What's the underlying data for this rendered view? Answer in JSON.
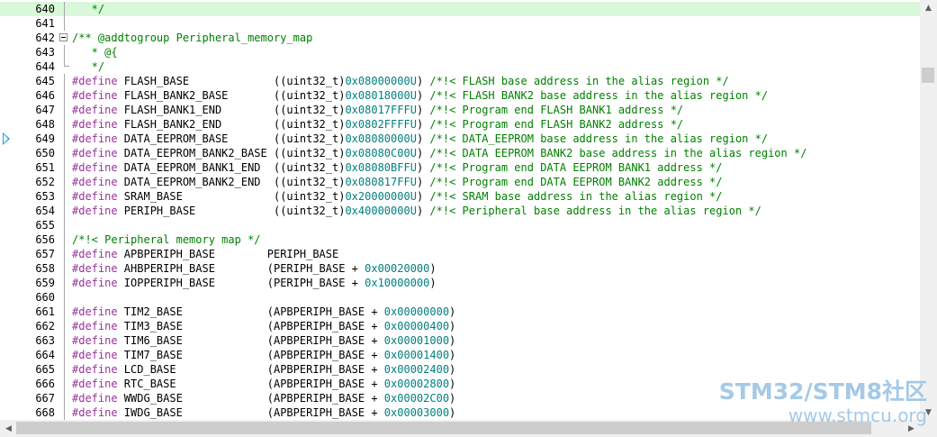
{
  "editor": {
    "lines": [
      {
        "num": "640",
        "tokens": [
          {
            "t": "   */",
            "c": "cm"
          }
        ]
      },
      {
        "num": "641",
        "tokens": []
      },
      {
        "num": "642",
        "tokens": [
          {
            "t": "/** @addtogroup Peripheral_memory_map",
            "c": "cm"
          }
        ]
      },
      {
        "num": "643",
        "tokens": [
          {
            "t": "   * @{",
            "c": "cm"
          }
        ]
      },
      {
        "num": "644",
        "tokens": [
          {
            "t": "   */",
            "c": "cm"
          }
        ]
      },
      {
        "num": "645",
        "tokens": [
          {
            "t": "#define",
            "c": "kw"
          },
          {
            "t": " FLASH_BASE             ((uint32_t)",
            "c": ""
          },
          {
            "t": "0x08000000U",
            "c": "num"
          },
          {
            "t": ") ",
            "c": ""
          },
          {
            "t": "/*!< FLASH base address in the alias region */",
            "c": "cm"
          }
        ]
      },
      {
        "num": "646",
        "tokens": [
          {
            "t": "#define",
            "c": "kw"
          },
          {
            "t": " FLASH_BANK2_BASE       ((uint32_t)",
            "c": ""
          },
          {
            "t": "0x08018000U",
            "c": "num"
          },
          {
            "t": ") ",
            "c": ""
          },
          {
            "t": "/*!< FLASH BANK2 base address in the alias region */",
            "c": "cm"
          }
        ]
      },
      {
        "num": "647",
        "tokens": [
          {
            "t": "#define",
            "c": "kw"
          },
          {
            "t": " FLASH_BANK1_END        ((uint32_t)",
            "c": ""
          },
          {
            "t": "0x08017FFFU",
            "c": "num"
          },
          {
            "t": ") ",
            "c": ""
          },
          {
            "t": "/*!< Program end FLASH BANK1 address */",
            "c": "cm"
          }
        ]
      },
      {
        "num": "648",
        "tokens": [
          {
            "t": "#define",
            "c": "kw"
          },
          {
            "t": " FLASH_BANK2_END        ((uint32_t)",
            "c": ""
          },
          {
            "t": "0x0802FFFFU",
            "c": "num"
          },
          {
            "t": ") ",
            "c": ""
          },
          {
            "t": "/*!< Program end FLASH BANK2 address */",
            "c": "cm"
          }
        ]
      },
      {
        "num": "649",
        "tokens": [
          {
            "t": "#define",
            "c": "kw"
          },
          {
            "t": " DATA_EEPROM_BASE       ((uint32_t)",
            "c": ""
          },
          {
            "t": "0x08080000U",
            "c": "num"
          },
          {
            "t": ") ",
            "c": ""
          },
          {
            "t": "/*!< DATA_EEPROM base address in the alias region */",
            "c": "cm"
          }
        ]
      },
      {
        "num": "650",
        "tokens": [
          {
            "t": "#define",
            "c": "kw"
          },
          {
            "t": " DATA_EEPROM_BANK2_BASE ((uint32_t)",
            "c": ""
          },
          {
            "t": "0x08080C00U",
            "c": "num"
          },
          {
            "t": ") ",
            "c": ""
          },
          {
            "t": "/*!< DATA EEPROM BANK2 base address in the alias region */",
            "c": "cm"
          }
        ]
      },
      {
        "num": "651",
        "tokens": [
          {
            "t": "#define",
            "c": "kw"
          },
          {
            "t": " DATA_EEPROM_BANK1_END  ((uint32_t)",
            "c": ""
          },
          {
            "t": "0x08080BFFU",
            "c": "num"
          },
          {
            "t": ") ",
            "c": ""
          },
          {
            "t": "/*!< Program end DATA EEPROM BANK1 address */",
            "c": "cm"
          }
        ]
      },
      {
        "num": "652",
        "tokens": [
          {
            "t": "#define",
            "c": "kw"
          },
          {
            "t": " DATA_EEPROM_BANK2_END  ((uint32_t)",
            "c": ""
          },
          {
            "t": "0x080817FFU",
            "c": "num"
          },
          {
            "t": ") ",
            "c": ""
          },
          {
            "t": "/*!< Program end DATA EEPROM BANK2 address */",
            "c": "cm"
          }
        ]
      },
      {
        "num": "653",
        "tokens": [
          {
            "t": "#define",
            "c": "kw"
          },
          {
            "t": " SRAM_BASE              ((uint32_t)",
            "c": ""
          },
          {
            "t": "0x20000000U",
            "c": "num"
          },
          {
            "t": ") ",
            "c": ""
          },
          {
            "t": "/*!< SRAM base address in the alias region */",
            "c": "cm"
          }
        ]
      },
      {
        "num": "654",
        "tokens": [
          {
            "t": "#define",
            "c": "kw"
          },
          {
            "t": " PERIPH_BASE            ((uint32_t)",
            "c": ""
          },
          {
            "t": "0x40000000U",
            "c": "num"
          },
          {
            "t": ") ",
            "c": ""
          },
          {
            "t": "/*!< Peripheral base address in the alias region */",
            "c": "cm"
          }
        ]
      },
      {
        "num": "655",
        "tokens": []
      },
      {
        "num": "656",
        "tokens": [
          {
            "t": "/*!< Peripheral memory map */",
            "c": "cm"
          }
        ]
      },
      {
        "num": "657",
        "tokens": [
          {
            "t": "#define",
            "c": "kw"
          },
          {
            "t": " APBPERIPH_BASE        PERIPH_BASE",
            "c": ""
          }
        ]
      },
      {
        "num": "658",
        "tokens": [
          {
            "t": "#define",
            "c": "kw"
          },
          {
            "t": " AHBPERIPH_BASE        (PERIPH_BASE + ",
            "c": ""
          },
          {
            "t": "0x00020000",
            "c": "num"
          },
          {
            "t": ")",
            "c": ""
          }
        ]
      },
      {
        "num": "659",
        "tokens": [
          {
            "t": "#define",
            "c": "kw"
          },
          {
            "t": " IOPPERIPH_BASE        (PERIPH_BASE + ",
            "c": ""
          },
          {
            "t": "0x10000000",
            "c": "num"
          },
          {
            "t": ")",
            "c": ""
          }
        ]
      },
      {
        "num": "660",
        "tokens": []
      },
      {
        "num": "661",
        "tokens": [
          {
            "t": "#define",
            "c": "kw"
          },
          {
            "t": " TIM2_BASE             (APBPERIPH_BASE + ",
            "c": ""
          },
          {
            "t": "0x00000000",
            "c": "num"
          },
          {
            "t": ")",
            "c": ""
          }
        ]
      },
      {
        "num": "662",
        "tokens": [
          {
            "t": "#define",
            "c": "kw"
          },
          {
            "t": " TIM3_BASE             (APBPERIPH_BASE + ",
            "c": ""
          },
          {
            "t": "0x00000400",
            "c": "num"
          },
          {
            "t": ")",
            "c": ""
          }
        ]
      },
      {
        "num": "663",
        "tokens": [
          {
            "t": "#define",
            "c": "kw"
          },
          {
            "t": " TIM6_BASE             (APBPERIPH_BASE + ",
            "c": ""
          },
          {
            "t": "0x00001000",
            "c": "num"
          },
          {
            "t": ")",
            "c": ""
          }
        ]
      },
      {
        "num": "664",
        "tokens": [
          {
            "t": "#define",
            "c": "kw"
          },
          {
            "t": " TIM7_BASE             (APBPERIPH_BASE + ",
            "c": ""
          },
          {
            "t": "0x00001400",
            "c": "num"
          },
          {
            "t": ")",
            "c": ""
          }
        ]
      },
      {
        "num": "665",
        "tokens": [
          {
            "t": "#define",
            "c": "kw"
          },
          {
            "t": " LCD_BASE              (APBPERIPH_BASE + ",
            "c": ""
          },
          {
            "t": "0x00002400",
            "c": "num"
          },
          {
            "t": ")",
            "c": ""
          }
        ]
      },
      {
        "num": "666",
        "tokens": [
          {
            "t": "#define",
            "c": "kw"
          },
          {
            "t": " RTC_BASE              (APBPERIPH_BASE + ",
            "c": ""
          },
          {
            "t": "0x00002800",
            "c": "num"
          },
          {
            "t": ")",
            "c": ""
          }
        ]
      },
      {
        "num": "667",
        "tokens": [
          {
            "t": "#define",
            "c": "kw"
          },
          {
            "t": " WWDG_BASE             (APBPERIPH_BASE + ",
            "c": ""
          },
          {
            "t": "0x00002C00",
            "c": "num"
          },
          {
            "t": ")",
            "c": ""
          }
        ]
      },
      {
        "num": "668",
        "tokens": [
          {
            "t": "#define",
            "c": "kw"
          },
          {
            "t": " IWDG_BASE             (APBPERIPH_BASE + ",
            "c": ""
          },
          {
            "t": "0x00003000",
            "c": "num"
          },
          {
            "t": ")",
            "c": ""
          }
        ]
      }
    ],
    "highlighted_line": "640",
    "current_line_marker": "649",
    "fold_open_line": "642",
    "fold_close_line": "644"
  },
  "scrollbars": {
    "up_icon": "triangle-up-icon",
    "down_icon": "triangle-down-icon",
    "left_icon": "triangle-left-icon",
    "right_icon": "triangle-right-icon"
  },
  "watermark": {
    "title": "STM32/STM8社区",
    "url": "www.stmcu.org"
  },
  "colors": {
    "keyword": "#993399",
    "comment": "#008000",
    "number": "#008080",
    "highlight": "#d9f7d9",
    "marker": "#1d9fd6"
  }
}
